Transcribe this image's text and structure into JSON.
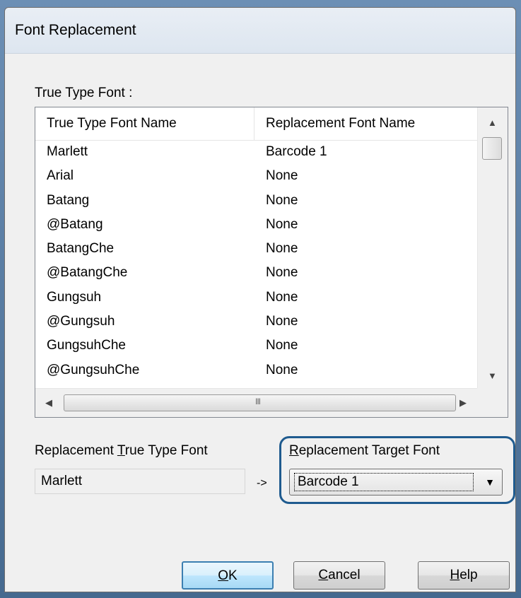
{
  "dialog": {
    "title": "Font Replacement",
    "group_label": "True Type Font :"
  },
  "list": {
    "columns": [
      "True Type Font Name",
      "Replacement Font Name"
    ],
    "rows": [
      [
        "Marlett",
        "Barcode 1"
      ],
      [
        "Arial",
        "None"
      ],
      [
        "Batang",
        "None"
      ],
      [
        "@Batang",
        "None"
      ],
      [
        "BatangChe",
        "None"
      ],
      [
        "@BatangChe",
        "None"
      ],
      [
        "Gungsuh",
        "None"
      ],
      [
        "@Gungsuh",
        "None"
      ],
      [
        "GungsuhChe",
        "None"
      ],
      [
        "@GungsuhChe",
        "None"
      ]
    ],
    "scroll_up": "▲",
    "scroll_down": "▼",
    "scroll_left": "◀",
    "scroll_right": "▶",
    "grip": "III"
  },
  "replacement": {
    "source_label_pre": "Replacement ",
    "source_label_key": "T",
    "source_label_post": "rue Type Font",
    "source_value": "Marlett",
    "arrow": "->",
    "target_label_key": "R",
    "target_label_post": "eplacement Target Font",
    "target_value": "Barcode 1",
    "dropdown_glyph": "▼"
  },
  "buttons": {
    "ok_key": "O",
    "ok_rest": "K",
    "cancel_key": "C",
    "cancel_rest": "ancel",
    "help_key": "H",
    "help_rest": "elp"
  },
  "colors": {
    "highlight_border": "#1f5b8f",
    "default_button_border": "#3c7fb1"
  }
}
